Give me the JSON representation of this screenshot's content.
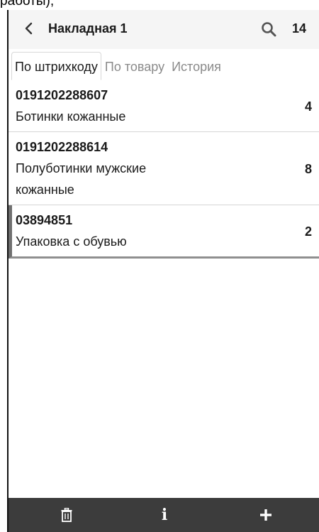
{
  "document_snippet": "работы);",
  "app_bar": {
    "title": "Накладная 1",
    "total": "14"
  },
  "icons": {
    "back": "chevron-left-icon",
    "search": "search-icon",
    "delete": "trash-icon",
    "info": "info-icon",
    "add": "plus-icon"
  },
  "tabs": [
    {
      "label": "По штрихкоду",
      "active": true
    },
    {
      "label": "По товару",
      "active": false
    },
    {
      "label": "История",
      "active": false
    }
  ],
  "items": [
    {
      "barcode": "0191202288607",
      "name": "Ботинки кожанные",
      "qty": "4"
    },
    {
      "barcode": "0191202288614",
      "name": "Полуботинки мужские кожанные",
      "qty": "8"
    },
    {
      "barcode": "03894851",
      "name": "Упаковка с обувью",
      "qty": "2"
    }
  ],
  "colors": {
    "app_bar_bg": "#f5f5f5",
    "bottom_bar_bg": "#3c3c3c",
    "selected_marker": "#707070"
  }
}
